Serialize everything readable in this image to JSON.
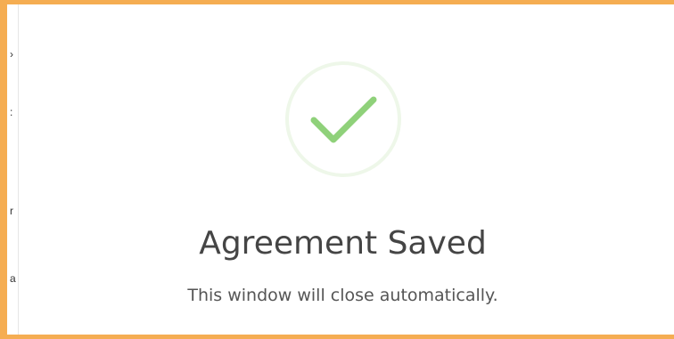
{
  "dialog": {
    "title": "Agreement Saved",
    "message": "This window will close automatically.",
    "icon": "checkmark-icon"
  },
  "colors": {
    "frame_border": "#f5ad52",
    "check_stroke": "#8fd17a",
    "check_ring": "#eef7e9",
    "title_text": "#454545",
    "message_text": "#555555"
  }
}
